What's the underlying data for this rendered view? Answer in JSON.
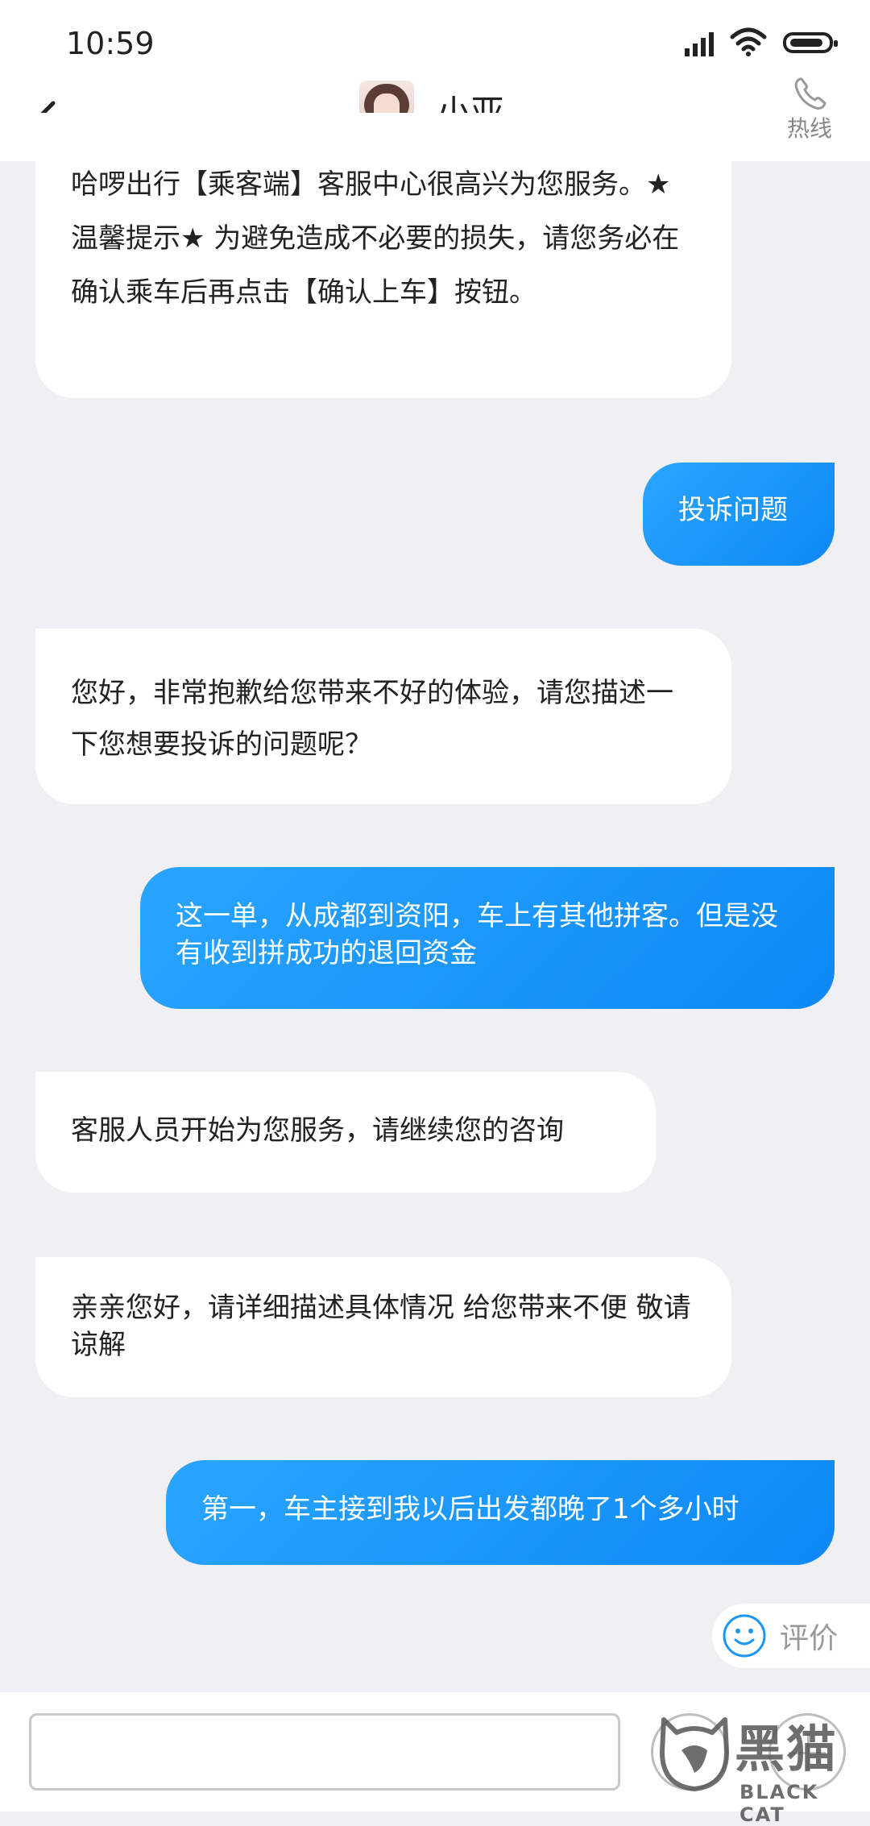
{
  "status_bar": {
    "time": "10:59"
  },
  "header": {
    "title": "小亚",
    "hotline_label": "热线"
  },
  "messages": [
    {
      "side": "left",
      "text": "哈啰出行【乘客端】客服中心很高兴为您服务。★温馨提示★ 为避免造成不必要的损失，请您务必在确认乘车后再点击【确认上车】按钮。"
    },
    {
      "side": "right",
      "text": "投诉问题"
    },
    {
      "side": "left",
      "text": "您好，非常抱歉给您带来不好的体验，请您描述一下您想要投诉的问题呢？"
    },
    {
      "side": "right",
      "text": "这一单，从成都到资阳，车上有其他拼客。但是没有收到拼成功的退回资金"
    },
    {
      "side": "left",
      "text": "客服人员开始为您服务，请继续您的咨询"
    },
    {
      "side": "left",
      "text": "亲亲您好，请详细描述具体情况 给您带来不便 敬请谅解"
    },
    {
      "side": "right",
      "text": "第一，车主接到我以后出发都晚了1个多小时"
    }
  ],
  "rating": {
    "label": "评价"
  },
  "input": {
    "value": "",
    "placeholder": ""
  },
  "watermark": {
    "cn": "黑猫",
    "en": "BLACK CAT"
  },
  "colors": {
    "accent": "#1a96fb",
    "background": "#efeff4"
  }
}
